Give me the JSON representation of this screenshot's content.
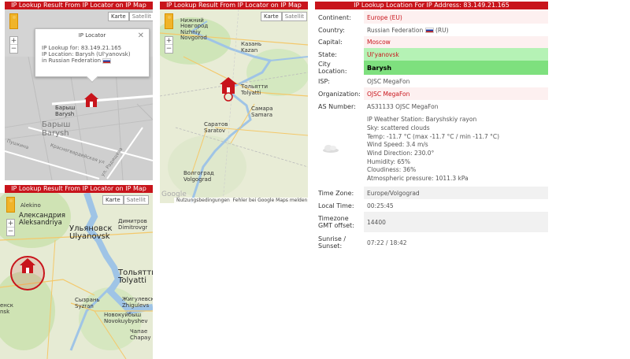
{
  "panels": {
    "map1_title": "IP Lookup Result From IP Locator on IP Map",
    "map2_title": "IP Lookup Result From IP Locator on IP Map",
    "map3_title": "IP Lookup Result From IP Locator on IP Map",
    "info_title": "IP Lookup Location For IP Address: 83.149.21.165"
  },
  "map_controls": {
    "map_label": "Karte",
    "satellite_label": "Satellit"
  },
  "map1": {
    "popup_title": "IP Locator",
    "popup_line1": "IP Lookup for: 83.149.21.165",
    "popup_line2": "IP Location: Barysh (Ul'yanovsk)",
    "popup_line3": "in Russian Federation",
    "labels": {
      "barysh_small": "Барыш",
      "barysh_en_small": "Barysh",
      "barysh_ru": "Барыш",
      "barysh_en": "Barysh",
      "road1": "Пушкина",
      "road2": "Красногвардейская ул",
      "road3": "ул. Радищева"
    }
  },
  "map2": {
    "labels": {
      "nn_ru": "Нижний",
      "nn_ru2": "Новгород",
      "nn_en": "Nizhniy",
      "nn_en2": "Novgorod",
      "kazan_ru": "Казань",
      "kazan_en": "Kazan",
      "tolyatti_ru": "Тольятти",
      "tolyatti_en": "Tolyatti",
      "samara_ru": "Самара",
      "samara_en": "Samara",
      "saratov_ru": "Саратов",
      "saratov_en": "Saratov",
      "volgograd_ru": "Волгоград",
      "volgograd_en": "Volgograd"
    },
    "google": "Google",
    "terms": "Nutzungsbedingungen",
    "report": "Fehler bei Google Maps melden"
  },
  "map3": {
    "labels": {
      "alekino": "Alekino",
      "aleksandriya_ru": "Александрия",
      "aleksandriya_en": "Aleksandriya",
      "ulyanovsk_ru": "Ульяновск",
      "ulyanovsk_en": "Ulyanovsk",
      "dimitrov_ru": "Димитров",
      "dimitrov_en": "Dimitrovgr",
      "tolyatti_ru": "Тольятти",
      "tolyatti_en": "Tolyatti",
      "syzran_ru": "Сызрань",
      "syzran_en": "Syzran",
      "zhigulevsk_ru": "Жигулевск",
      "zhigulevsk_en": "Zhigulevs",
      "novokuib_ru": "Новокуйбыш",
      "novokuib_en": "Novokuybyshev",
      "chapaev_ru": "Чапае",
      "chapaev_en": "Chapay",
      "nsk_ru": "енск",
      "nsk_en": "nsk"
    }
  },
  "info": {
    "continent_key": "Continent:",
    "continent_val": "Europe (EU)",
    "country_key": "Country:",
    "country_val": "Russian Federation",
    "country_code": "(RU)",
    "capital_key": "Capital:",
    "capital_val": "Moscow",
    "state_key": "State:",
    "state_val": "Ul'yanovsk",
    "city_key": "City Location:",
    "city_val": "Barysh",
    "isp_key": "ISP:",
    "isp_val": "OJSC MegaFon",
    "org_key": "Organization:",
    "org_val": "OJSC MegaFon",
    "as_key": "AS Number:",
    "as_val": "AS31133 OJSC MegaFon",
    "weather": [
      "IP Weather Station: Baryshskiy rayon",
      "Sky: scattered clouds",
      "Temp: -11.7 °C (max -11.7 °C / min -11.7 °C)",
      "Wind Speed: 3.4 m/s",
      "Wind Direction: 230.0°",
      "Humidity: 65%",
      "Cloudiness: 36%",
      "Atmospheric pressure: 1011.3 kPa"
    ],
    "tz_key": "Time Zone:",
    "tz_val": "Europe/Volgograd",
    "local_key": "Local Time:",
    "local_val": "00:25:45",
    "gmt_key": "Timezone GMT offset:",
    "gmt_val": "14400",
    "sun_key": "Sunrise / Sunset:",
    "sun_val": "07:22 / 18:42"
  },
  "colors": {
    "title_bar": "#c8141b",
    "highlight_green": "#7ee07e",
    "light_green": "#b5f2b5"
  }
}
